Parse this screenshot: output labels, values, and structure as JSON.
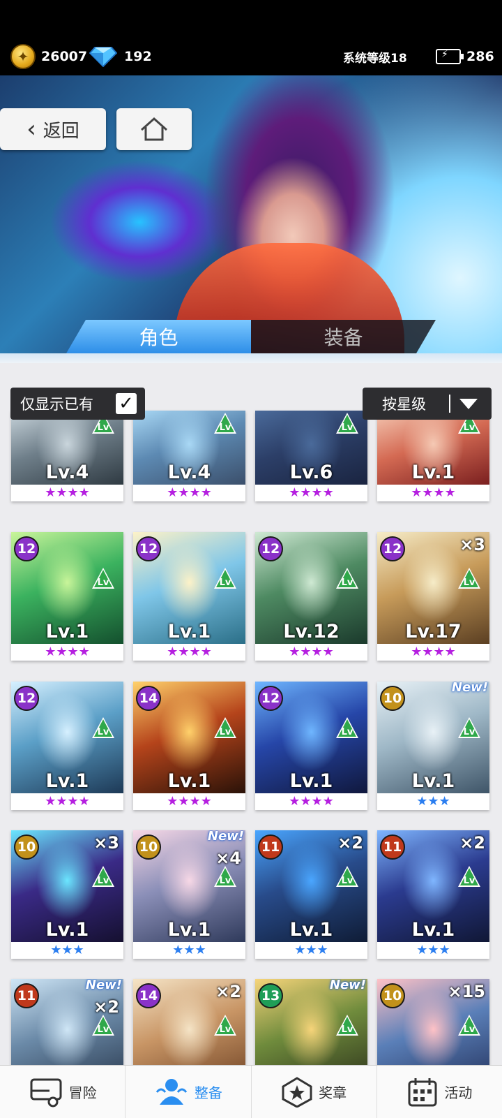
{
  "resources": {
    "coins": "26007",
    "gems": "192",
    "system_level": "系统等级18",
    "energy": "286"
  },
  "nav": {
    "back_label": "返回"
  },
  "tabs": [
    {
      "label": "角色",
      "active": true
    },
    {
      "label": "装备",
      "active": false
    }
  ],
  "filters": {
    "owned_only_label": "仅显示已有",
    "owned_only_checked": true,
    "sort_label": "按星级"
  },
  "cards": [
    {
      "level": "Lv.4",
      "stars": "★★★★",
      "star_color": "#b51fe0",
      "rank": "",
      "count": "",
      "new": false,
      "palette": [
        "#c9d5dc",
        "#6f7f8a",
        "#2f3a42"
      ]
    },
    {
      "level": "Lv.4",
      "stars": "★★★★",
      "star_color": "#b51fe0",
      "rank": "",
      "count": "",
      "new": false,
      "palette": [
        "#a9d8f5",
        "#5d8ab3",
        "#3b4f6b"
      ]
    },
    {
      "level": "Lv.6",
      "stars": "★★★★",
      "star_color": "#b51fe0",
      "rank": "",
      "count": "",
      "new": false,
      "palette": [
        "#4a6a9a",
        "#2c3f68",
        "#1a2440"
      ]
    },
    {
      "level": "Lv.1",
      "stars": "★★★★",
      "star_color": "#b51fe0",
      "rank": "",
      "count": "",
      "new": false,
      "palette": [
        "#f5c9b4",
        "#d46a53",
        "#7a1f1f"
      ]
    },
    {
      "level": "Lv.1",
      "stars": "★★★★",
      "star_color": "#b51fe0",
      "rank": "12",
      "rank_color": "#8a32c8",
      "count": "",
      "new": false,
      "palette": [
        "#c9f59a",
        "#3bb25f",
        "#14502e"
      ]
    },
    {
      "level": "Lv.1",
      "stars": "★★★★",
      "star_color": "#b51fe0",
      "rank": "12",
      "rank_color": "#8a32c8",
      "count": "",
      "new": false,
      "palette": [
        "#fdf2c8",
        "#7fc6e8",
        "#2b6f88"
      ]
    },
    {
      "level": "Lv.12",
      "stars": "★★★★",
      "star_color": "#b51fe0",
      "rank": "12",
      "rank_color": "#8a32c8",
      "count": "",
      "new": false,
      "palette": [
        "#cfe9d3",
        "#4e8a62",
        "#1b3a2c"
      ]
    },
    {
      "level": "Lv.17",
      "stars": "★★★★",
      "star_color": "#b51fe0",
      "rank": "12",
      "rank_color": "#8a32c8",
      "count": "×3",
      "new": false,
      "palette": [
        "#f6ecc8",
        "#c79b5a",
        "#5b3f22"
      ]
    },
    {
      "level": "Lv.1",
      "stars": "★★★★",
      "star_color": "#b51fe0",
      "rank": "12",
      "rank_color": "#8a32c8",
      "count": "",
      "new": false,
      "palette": [
        "#d6f0ff",
        "#5b9fc7",
        "#1d3956"
      ]
    },
    {
      "level": "Lv.1",
      "stars": "★★★★",
      "star_color": "#b51fe0",
      "rank": "14",
      "rank_color": "#8a32c8",
      "count": "",
      "new": false,
      "palette": [
        "#ffd16b",
        "#b5441b",
        "#2a1208"
      ]
    },
    {
      "level": "Lv.1",
      "stars": "★★★★",
      "star_color": "#b51fe0",
      "rank": "12",
      "rank_color": "#8a32c8",
      "count": "",
      "new": false,
      "palette": [
        "#6fb6ff",
        "#2646a8",
        "#10183d"
      ]
    },
    {
      "level": "Lv.1",
      "stars": "★★★",
      "star_color": "#2b7ef0",
      "rank": "10",
      "rank_color": "#c2911b",
      "count": "",
      "new": true,
      "palette": [
        "#e8f1f6",
        "#9fb8c7",
        "#3f5568"
      ]
    },
    {
      "level": "Lv.1",
      "stars": "★★★",
      "star_color": "#2b7ef0",
      "rank": "10",
      "rank_color": "#c2911b",
      "count": "×3",
      "new": false,
      "palette": [
        "#6be6ff",
        "#3a2a86",
        "#151030"
      ]
    },
    {
      "level": "Lv.1",
      "stars": "★★★",
      "star_color": "#2b7ef0",
      "rank": "10",
      "rank_color": "#c2911b",
      "count": "×4",
      "new": true,
      "palette": [
        "#f7d8e6",
        "#8b8fb8",
        "#2f3a5b"
      ]
    },
    {
      "level": "Lv.1",
      "stars": "★★★",
      "star_color": "#2b7ef0",
      "rank": "11",
      "rank_color": "#c0391c",
      "count": "×2",
      "new": false,
      "palette": [
        "#4aa6ff",
        "#284b8a",
        "#0f1c36"
      ]
    },
    {
      "level": "Lv.1",
      "stars": "★★★",
      "star_color": "#2b7ef0",
      "rank": "11",
      "rank_color": "#c0391c",
      "count": "×2",
      "new": false,
      "palette": [
        "#7fb6ff",
        "#2b3b8f",
        "#101735"
      ]
    },
    {
      "level": "Lv",
      "stars": "",
      "star_color": "#2b7ef0",
      "rank": "11",
      "rank_color": "#c0391c",
      "count": "×2",
      "new": true,
      "palette": [
        "#cfe6f6",
        "#6b8aa8",
        "#27364b"
      ]
    },
    {
      "level": "Lv",
      "stars": "",
      "star_color": "#2b7ef0",
      "rank": "14",
      "rank_color": "#8a32c8",
      "count": "×2",
      "new": false,
      "palette": [
        "#f5e4c6",
        "#c89565",
        "#6b3f22"
      ]
    },
    {
      "level": "Lv",
      "stars": "",
      "star_color": "#2b7ef0",
      "rank": "13",
      "rank_color": "#1f9e57",
      "count": "",
      "new": true,
      "palette": [
        "#f6d47a",
        "#6f8b3c",
        "#2a2f1a"
      ]
    },
    {
      "level": "Lv",
      "stars": "",
      "star_color": "#2b7ef0",
      "rank": "10",
      "rank_color": "#c2911b",
      "count": "×15",
      "new": false,
      "palette": [
        "#ffc2c6",
        "#5a7fb8",
        "#22305a"
      ]
    }
  ],
  "lv_badge_label": "Lv",
  "new_label": "New!",
  "bottom_nav": [
    {
      "label": "冒险",
      "icon": "truck-icon",
      "active": false
    },
    {
      "label": "整备",
      "icon": "team-icon",
      "active": true
    },
    {
      "label": "奖章",
      "icon": "medal-icon",
      "active": false
    },
    {
      "label": "活动",
      "icon": "calendar-icon",
      "active": false
    }
  ]
}
